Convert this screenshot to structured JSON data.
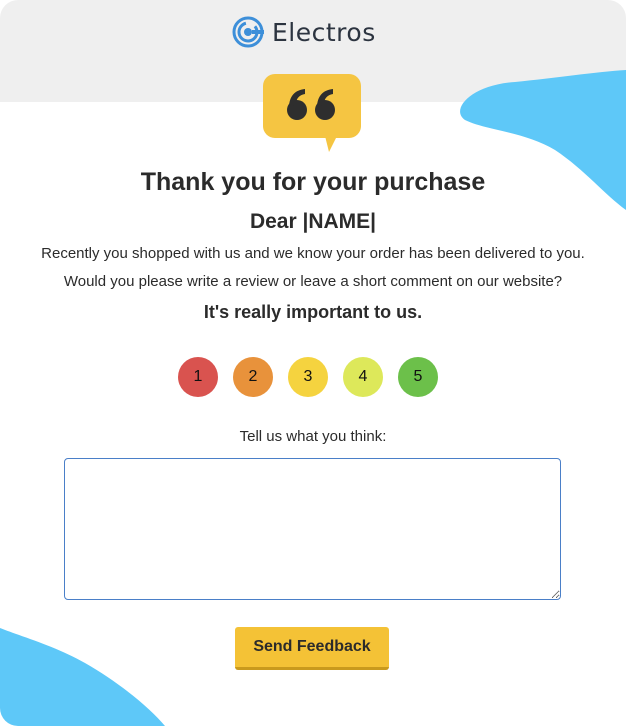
{
  "brand": {
    "name": "Electros",
    "logo_icon": "target-icon"
  },
  "badge": {
    "icon": "quote-icon",
    "color": "#f5c542"
  },
  "message": {
    "title": "Thank you for your purchase",
    "greeting": "Dear |NAME|",
    "line1": "Recently you shopped with us and we know your order has been delivered to you.",
    "line2": "Would you please write a review or leave a short comment on our website?",
    "emphasis": "It's really important to us."
  },
  "rating": {
    "options": [
      {
        "label": "1",
        "color": "#d9534f"
      },
      {
        "label": "2",
        "color": "#e8923b"
      },
      {
        "label": "3",
        "color": "#f5d33f"
      },
      {
        "label": "4",
        "color": "#dde85a"
      },
      {
        "label": "5",
        "color": "#6cc04a"
      }
    ]
  },
  "feedback": {
    "prompt": "Tell us what you think:",
    "value": "",
    "submit_label": "Send Feedback"
  },
  "colors": {
    "accent_blue": "#5ec8f8",
    "header_bg": "#efefef",
    "button": "#f4c236"
  }
}
